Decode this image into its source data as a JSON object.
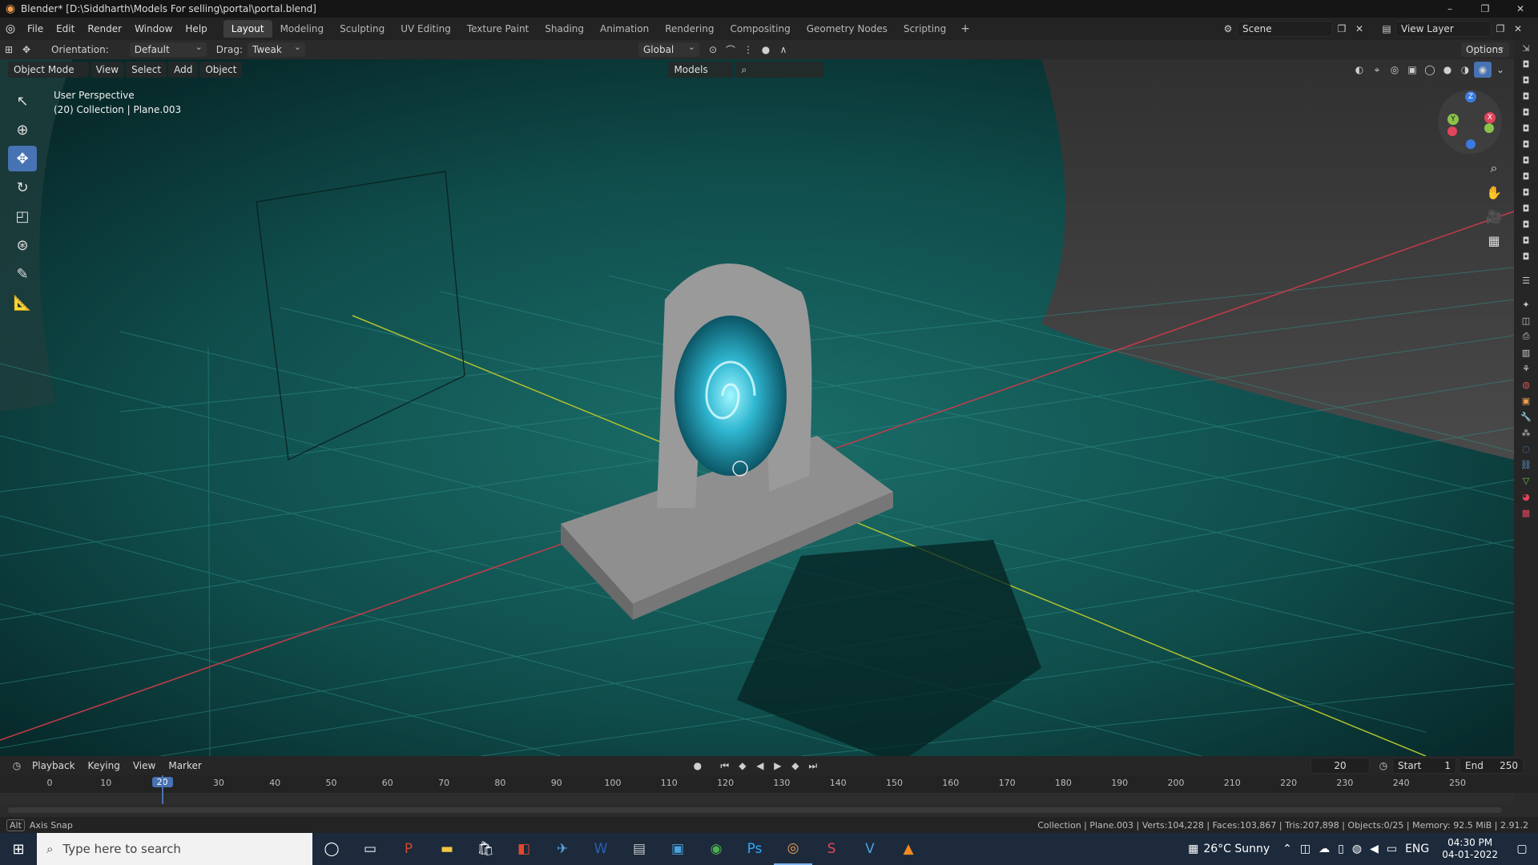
{
  "window": {
    "title": "Blender* [D:\\Siddharth\\Models For selling\\portal\\portal.blend]",
    "controls": [
      "–",
      "❐",
      "✕"
    ]
  },
  "menu": [
    "File",
    "Edit",
    "Render",
    "Window",
    "Help"
  ],
  "workspaces": [
    "Layout",
    "Modeling",
    "Sculpting",
    "UV Editing",
    "Texture Paint",
    "Shading",
    "Animation",
    "Rendering",
    "Compositing",
    "Geometry Nodes",
    "Scripting"
  ],
  "active_workspace": "Layout",
  "scene": {
    "label": "Scene",
    "view_layer": "View Layer"
  },
  "tool_header": {
    "orientation_label": "Orientation:",
    "orientation_value": "Default",
    "drag_label": "Drag:",
    "drag_value": "Tweak",
    "transform_space": "Global",
    "options": "Options"
  },
  "viewport_header": {
    "mode": "Object Mode",
    "items": [
      "View",
      "Select",
      "Add",
      "Object"
    ],
    "asset_lib": "Models"
  },
  "viewport_info": {
    "line1": "User Perspective",
    "line2": "(20) Collection | Plane.003"
  },
  "gizmo": {
    "x": "X",
    "y": "Y",
    "z": "Z"
  },
  "timeline": {
    "menus": [
      "Playback",
      "Keying",
      "View",
      "Marker"
    ],
    "current_frame": "20",
    "start_label": "Start",
    "start": "1",
    "end_label": "End",
    "end": "250",
    "ticks": [
      "0",
      "10",
      "20",
      "30",
      "40",
      "50",
      "60",
      "70",
      "80",
      "90",
      "100",
      "110",
      "120",
      "130",
      "140",
      "150",
      "160",
      "170",
      "180",
      "190",
      "200",
      "210",
      "220",
      "230",
      "240",
      "250"
    ]
  },
  "status": {
    "left_key": "Alt",
    "left": "Axis Snap",
    "right": "Collection | Plane.003 | Verts:104,228 | Faces:103,867 | Tris:207,898 | Objects:0/25 | Memory: 92.5 MiB | 2.91.2"
  },
  "taskbar": {
    "search_placeholder": "Type here to search",
    "weather": "26°C  Sunny",
    "lang": "ENG",
    "time": "04:30 PM",
    "date": "04-01-2022"
  },
  "colors": {
    "accent": "#4772b3",
    "viewport_bg": "#0c3a3a",
    "x_axis": "#c83a4a",
    "y_axis": "#b0c030"
  }
}
